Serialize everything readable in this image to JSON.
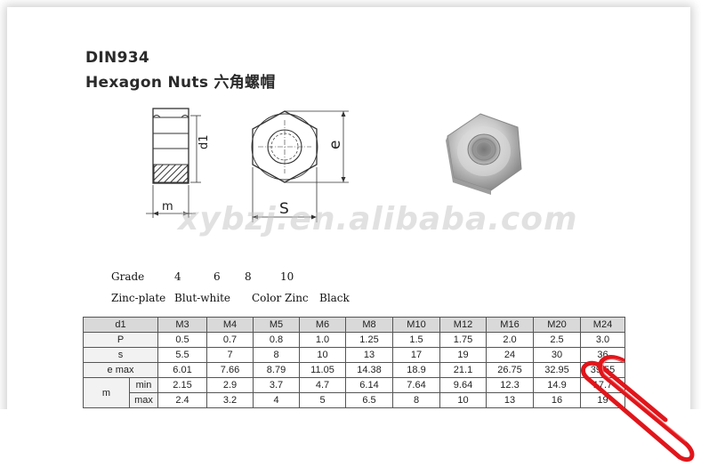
{
  "header": {
    "title": "DIN934",
    "subtitle": "Hexagon Nuts  六角螺帽"
  },
  "drawing": {
    "label_d1": "d1",
    "label_e": "e",
    "label_m": "m",
    "label_s": "S"
  },
  "watermark": "xybzj.en.alibaba.com",
  "specs": {
    "grade_label": "Grade",
    "grades": [
      "4",
      "6",
      "8",
      "10"
    ],
    "zinc_label": "Zinc-plate",
    "finishes": [
      "Blut-white",
      "Color Zinc",
      "Black"
    ]
  },
  "table": {
    "header": [
      "d1",
      "M3",
      "M4",
      "M5",
      "M6",
      "M8",
      "M10",
      "M12",
      "M16",
      "M20",
      "M24"
    ],
    "rows": {
      "p": {
        "label": "P",
        "values": [
          "0.5",
          "0.7",
          "0.8",
          "1.0",
          "1.25",
          "1.5",
          "1.75",
          "2.0",
          "2.5",
          "3.0"
        ]
      },
      "s": {
        "label": "s",
        "values": [
          "5.5",
          "7",
          "8",
          "10",
          "13",
          "17",
          "19",
          "24",
          "30",
          "36"
        ]
      },
      "e": {
        "label": "e max",
        "values": [
          "6.01",
          "7.66",
          "8.79",
          "11.05",
          "14.38",
          "18.9",
          "21.1",
          "26.75",
          "32.95",
          "39.55"
        ]
      },
      "m_label": "m",
      "mmin": {
        "label": "min",
        "values": [
          "2.15",
          "2.9",
          "3.7",
          "4.7",
          "6.14",
          "7.64",
          "9.64",
          "12.3",
          "14.9",
          "17.7"
        ]
      },
      "mmax": {
        "label": "max",
        "values": [
          "2.4",
          "3.2",
          "4",
          "5",
          "6.5",
          "8",
          "10",
          "13",
          "16",
          "19"
        ]
      }
    }
  },
  "colors": {
    "paperclip": "#e0161b",
    "hatch": "#333333"
  }
}
